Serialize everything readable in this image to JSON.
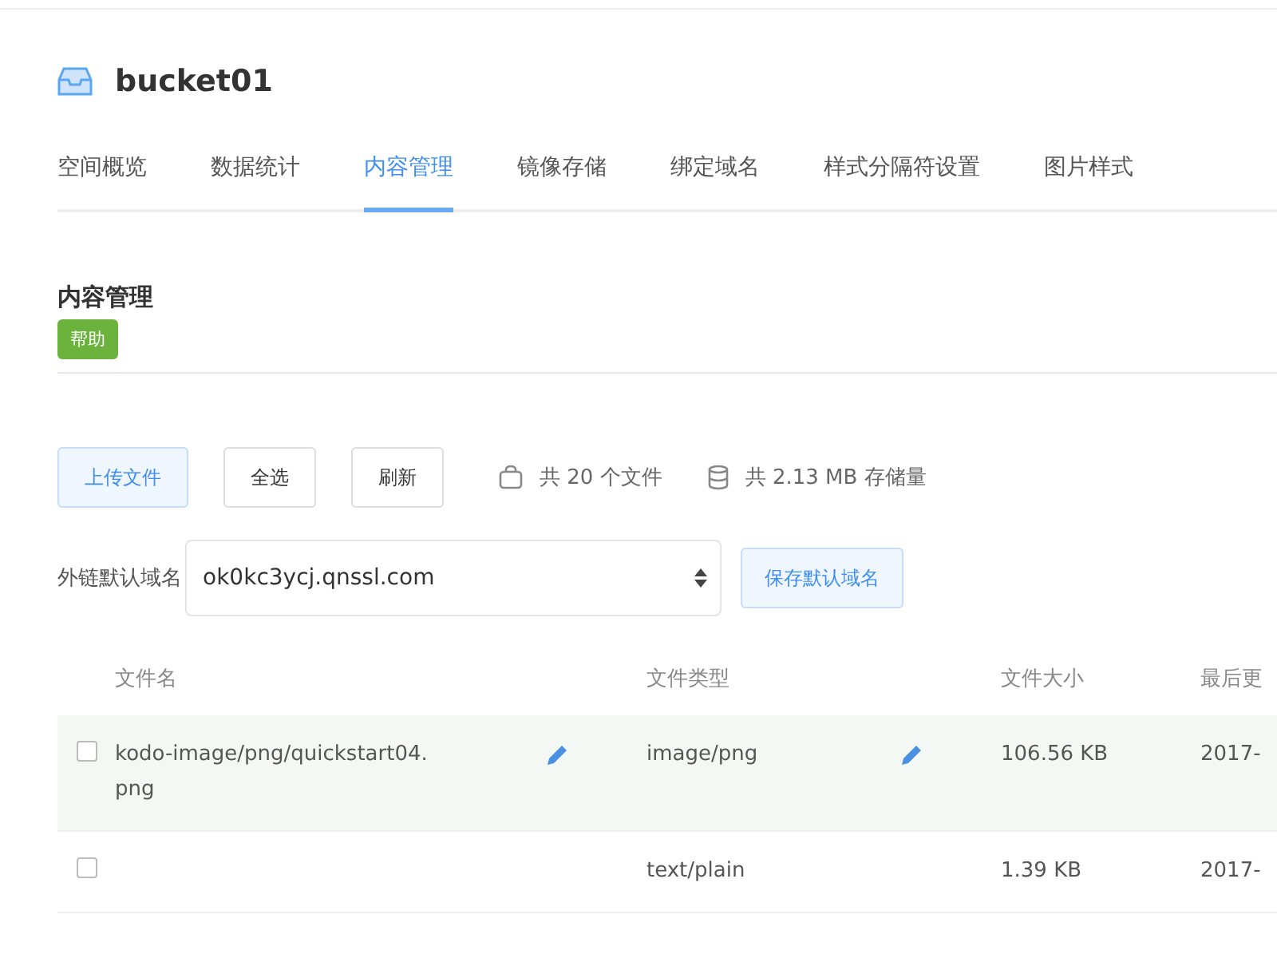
{
  "bucket": {
    "name": "bucket01"
  },
  "tabs": [
    {
      "label": "空间概览",
      "selected": false
    },
    {
      "label": "数据统计",
      "selected": false
    },
    {
      "label": "内容管理",
      "selected": true
    },
    {
      "label": "镜像存储",
      "selected": false
    },
    {
      "label": "绑定域名",
      "selected": false
    },
    {
      "label": "样式分隔符设置",
      "selected": false
    },
    {
      "label": "图片样式",
      "selected": false
    }
  ],
  "section": {
    "title": "内容管理",
    "help": "帮助"
  },
  "toolbar": {
    "buttons": [
      {
        "label": "上传文件",
        "kind": "primary"
      },
      {
        "label": "全选",
        "kind": "default"
      },
      {
        "label": "刷新",
        "kind": "default"
      }
    ],
    "file_count": "共 20 个文件",
    "storage": "共 2.13 MB 存储量"
  },
  "domain": {
    "label": "外链默认域名",
    "value": "ok0kc3ycj.qnssl.com",
    "save": "保存默认域名"
  },
  "table": {
    "columns": [
      "文件名",
      "文件类型",
      "文件大小",
      "最后更"
    ],
    "rows": [
      {
        "checked": false,
        "highlighted": true,
        "name": "kodo-image/png/quickstart04.png",
        "type": "image/png",
        "size": "106.56 KB",
        "updated": "2017-",
        "editable": true
      },
      {
        "checked": false,
        "highlighted": false,
        "name": "",
        "type": "text/plain",
        "size": "1.39 KB",
        "updated": "2017-",
        "editable": false
      }
    ]
  }
}
